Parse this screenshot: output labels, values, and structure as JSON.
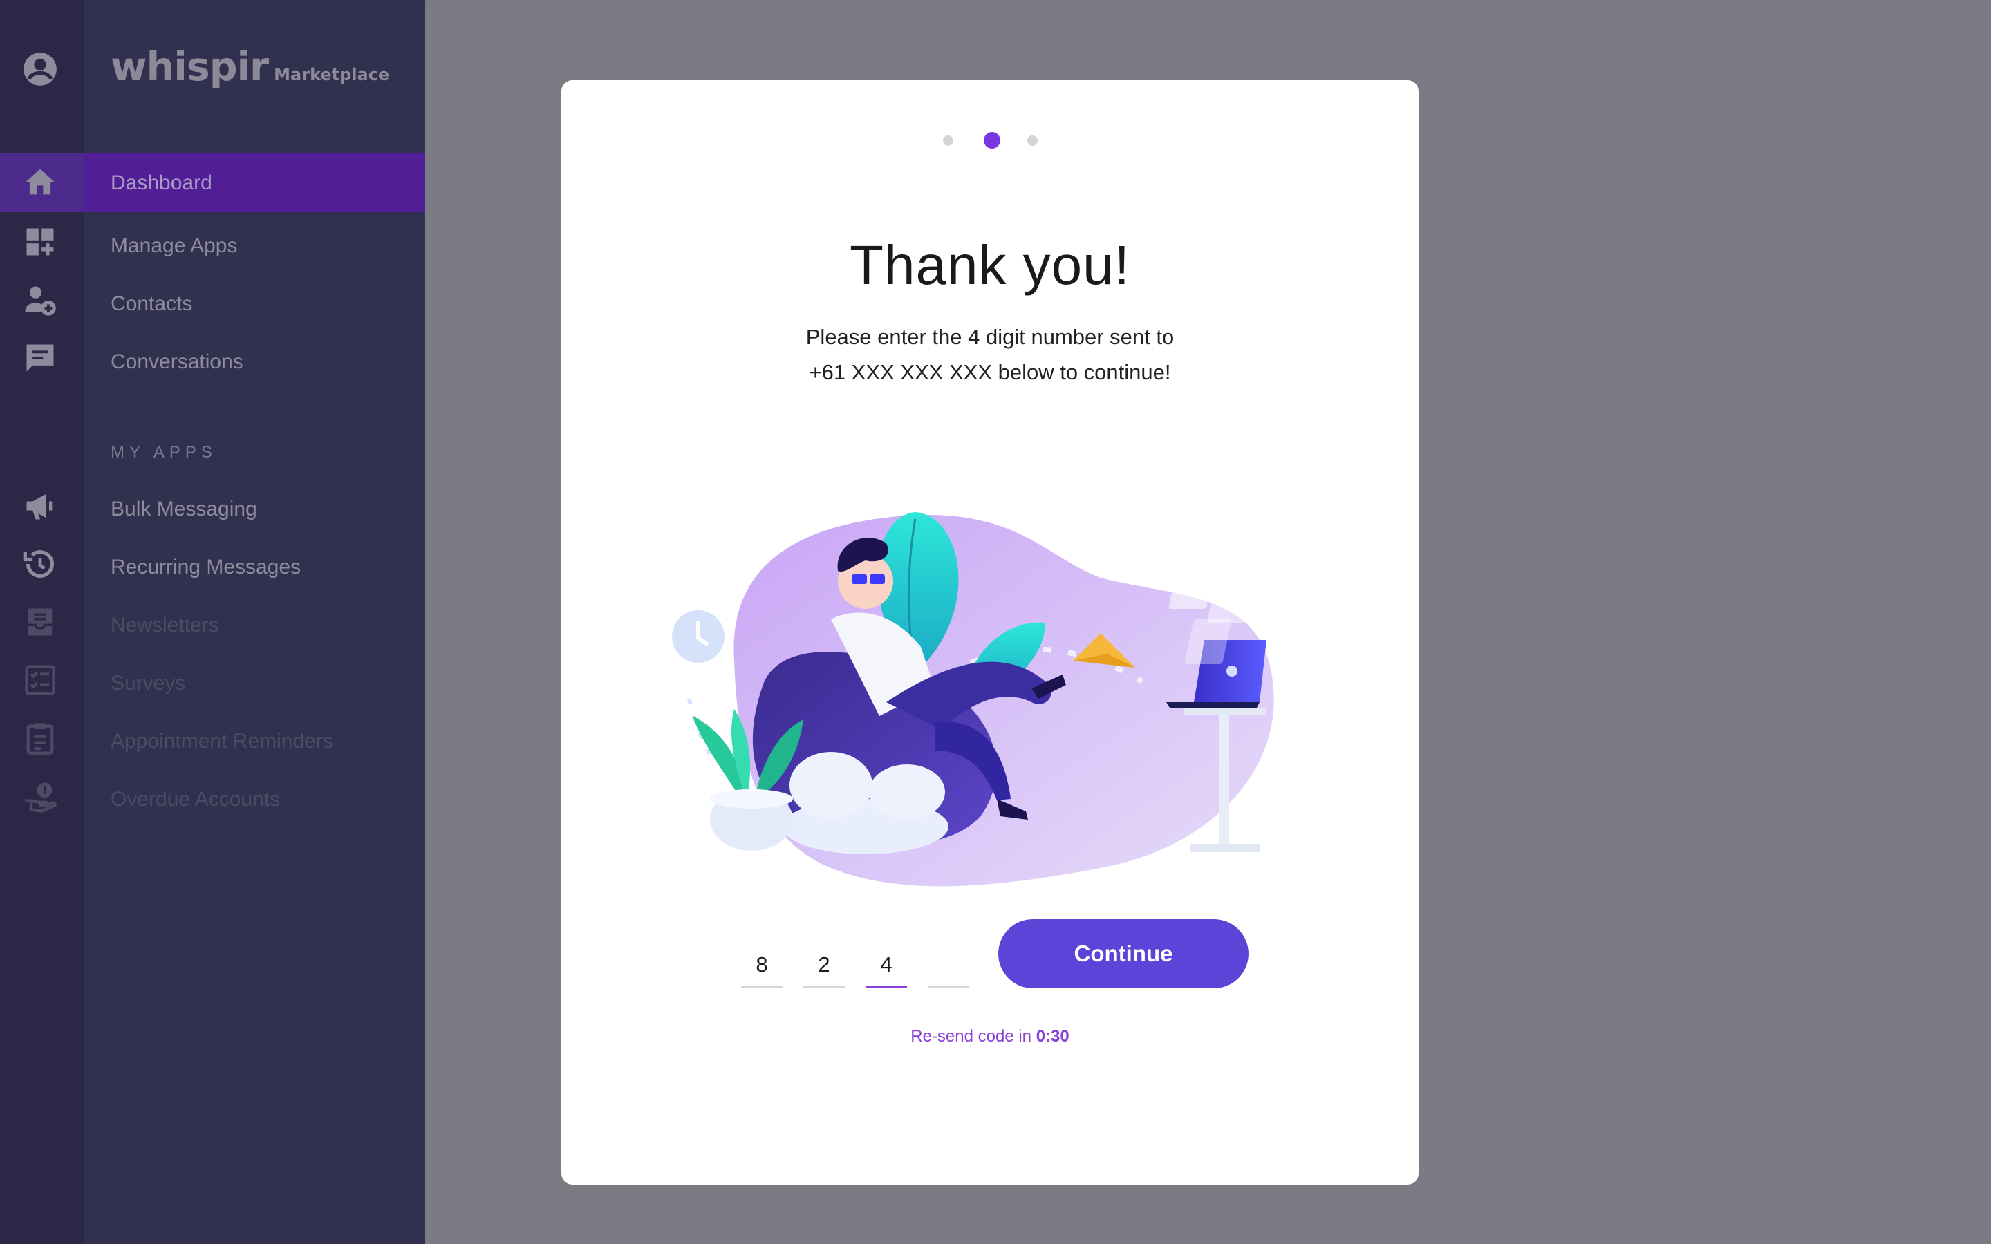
{
  "sidebar": {
    "logo": "whispir",
    "logo_sub": "Marketplace",
    "items": [
      {
        "label": "Dashboard"
      },
      {
        "label": "Manage Apps"
      },
      {
        "label": "Contacts"
      },
      {
        "label": "Conversations"
      }
    ],
    "section_label": "MY APPS",
    "apps": [
      {
        "label": "Bulk Messaging"
      },
      {
        "label": "Recurring Messages"
      },
      {
        "label": "Newsletters"
      },
      {
        "label": "Surveys"
      },
      {
        "label": "Appointment Reminders"
      },
      {
        "label": "Overdue Accounts"
      }
    ]
  },
  "rail_icons": [
    "account-icon",
    "home-icon",
    "add-apps-icon",
    "add-contact-icon",
    "conversation-icon",
    "megaphone-icon",
    "history-icon",
    "inbox-icon",
    "checklist-icon",
    "clipboard-icon",
    "money-hand-icon"
  ],
  "modal": {
    "step": {
      "current": 2,
      "total": 3
    },
    "title": "Thank you!",
    "desc_line1": "Please enter the 4 digit number sent to",
    "desc_line2": "+61 XXX XXX XXX below to continue!",
    "code_digits": [
      "8",
      "2",
      "4",
      ""
    ],
    "continue_label": "Continue",
    "resend_prefix": "Re-send code in",
    "resend_time": "0:30"
  },
  "colors": {
    "accent": "#8a3fd6",
    "button": "#5b45d8",
    "sidebar": "#32304f",
    "rail": "#2a2747",
    "active_nav": "#521e96"
  }
}
